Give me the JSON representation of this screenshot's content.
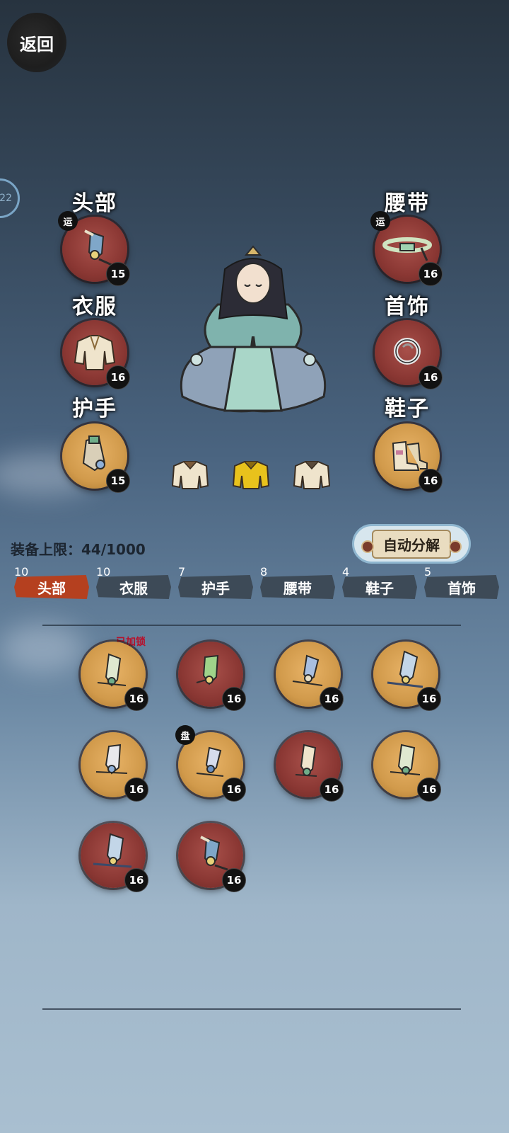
{
  "nav": {
    "back_label": "返回"
  },
  "side_badge": {
    "text": "22"
  },
  "equipment": {
    "head": {
      "label": "头部",
      "level": "15",
      "tag": "运"
    },
    "belt": {
      "label": "腰带",
      "level": "16",
      "tag": "运"
    },
    "clothes": {
      "label": "衣服",
      "level": "16"
    },
    "necklace": {
      "label": "首饰",
      "level": "16"
    },
    "gloves": {
      "label": "护手",
      "level": "15"
    },
    "shoes": {
      "label": "鞋子",
      "level": "16"
    }
  },
  "inventory": {
    "capacity_label": "装备上限：44/1000"
  },
  "actions": {
    "auto_decompose": "自动分解"
  },
  "tabs": [
    {
      "label": "头部",
      "count": "10",
      "active": true
    },
    {
      "label": "衣服",
      "count": "10"
    },
    {
      "label": "护手",
      "count": "7"
    },
    {
      "label": "腰带",
      "count": "8"
    },
    {
      "label": "鞋子",
      "count": "4"
    },
    {
      "label": "首饰",
      "count": "5"
    }
  ],
  "items": [
    {
      "color": "gold",
      "level": "16",
      "status": "已加锁"
    },
    {
      "color": "red",
      "level": "16"
    },
    {
      "color": "gold",
      "level": "16"
    },
    {
      "color": "gold",
      "level": "16"
    },
    {
      "color": "gold",
      "level": "16"
    },
    {
      "color": "gold",
      "level": "16",
      "tag": "盘"
    },
    {
      "color": "red",
      "level": "16"
    },
    {
      "color": "gold",
      "level": "16"
    },
    {
      "color": "red",
      "level": "16"
    },
    {
      "color": "red",
      "level": "16"
    }
  ]
}
